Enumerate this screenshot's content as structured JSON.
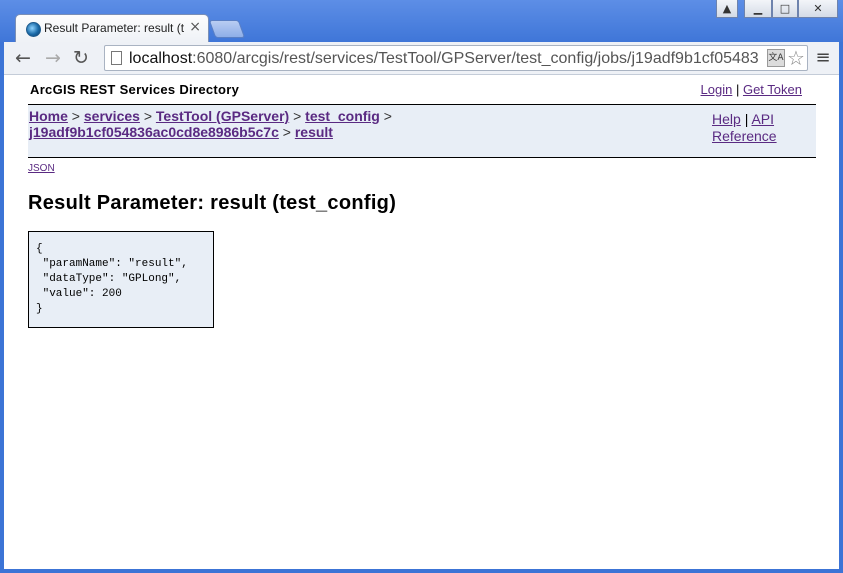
{
  "browser": {
    "tab_title": "Result Parameter: result (tes",
    "tab_close": "×",
    "url_host": "localhost",
    "url_rest": ":6080/arcgis/rest/services/TestTool/GPServer/test_config/jobs/j19adf9b1cf05483",
    "back_label": "←",
    "forward_label": "→",
    "reload_label": "↻",
    "menu_label": "≡",
    "star_label": "☆",
    "translate_label": "文A",
    "win_min": "▁",
    "win_max": "□",
    "win_close": "✕",
    "win_user": "▲"
  },
  "header": {
    "title": "ArcGIS REST Services Directory",
    "login": "Login",
    "separator": "|",
    "get_token": "Get Token"
  },
  "breadcrumb": {
    "items": [
      "Home",
      "services",
      "TestTool (GPServer)",
      "test_config",
      "j19adf9b1cf054836ac0cd8e8986b5c7c",
      "result"
    ],
    "sep": ">"
  },
  "help": {
    "help": "Help",
    "separator": "|",
    "api": "API",
    "reference": "Reference"
  },
  "json_link": "JSON",
  "page_title": "Result Parameter: result (test_config)",
  "result_json": "{\n \"paramName\": \"result\",\n \"dataType\": \"GPLong\",\n \"value\": 200\n}"
}
